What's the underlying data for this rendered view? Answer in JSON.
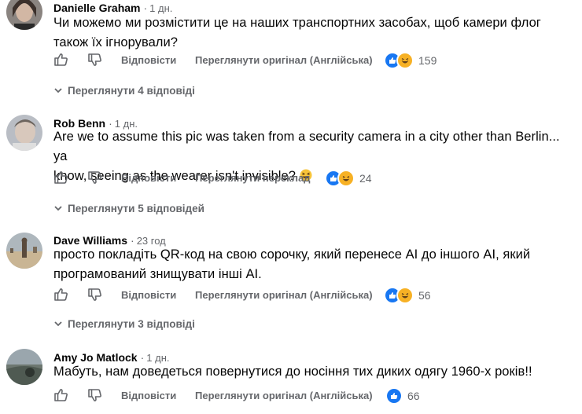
{
  "comments": [
    {
      "author": "Danielle Graham",
      "time": "1 дн.",
      "text_lines": [
        "Чи можемо ми розмістити це на наших транспортних засобах, щоб камери флог",
        "також їх ігнорували?"
      ],
      "reply_label": "Відповісти",
      "translate_label": "Переглянути оригінал (Англійська)",
      "reaction_icons": [
        "like",
        "haha"
      ],
      "reaction_count": "159",
      "view_replies": "Переглянути 4 відповіді"
    },
    {
      "author": "Rob Benn",
      "time": "1 дн.",
      "text_lines": [
        "Are we to assume this pic was taken from a security camera in a city other than Berlin... ya",
        "know, seeing as the wearer isn't invisible?"
      ],
      "trailing_emoji": "grinning-squinting-emoji",
      "reply_label": "Відповісти",
      "translate_label": "Переглянути переклад",
      "reaction_icons": [
        "like",
        "haha"
      ],
      "reaction_count": "24",
      "view_replies": "Переглянути 5 відповідей"
    },
    {
      "author": "Dave Williams",
      "time": "23 год",
      "text_lines": [
        "просто покладіть QR-код на свою сорочку, який перенесе AI до іншого AI, який",
        "програмований знищувати інші AI."
      ],
      "reply_label": "Відповісти",
      "translate_label": "Переглянути оригінал (Англійська)",
      "reaction_icons": [
        "like",
        "haha"
      ],
      "reaction_count": "56",
      "view_replies": "Переглянути 3 відповіді"
    },
    {
      "author": "Amy Jo Matlock",
      "time": "1 дн.",
      "text_lines": [
        "Мабуть, нам доведеться повернутися до носіння тих диких одягу 1960-х років!!"
      ],
      "reply_label": "Відповісти",
      "translate_label": "Переглянути оригінал (Англійська)",
      "reaction_icons": [
        "like"
      ],
      "reaction_count": "66"
    }
  ],
  "colors": {
    "text": "#050505",
    "secondary": "#65676b",
    "like_blue": "#1877f2",
    "haha_yellow": "#f7b125"
  }
}
